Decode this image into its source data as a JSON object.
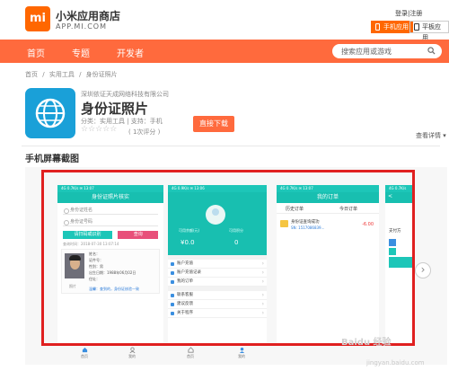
{
  "header": {
    "brand": "小米应用商店",
    "url": "APP.MI.COM",
    "login": "登录",
    "sep": "|",
    "register": "注册",
    "phone_tab": "手机应用",
    "pad_tab": "平板应用"
  },
  "nav": {
    "items": [
      "首页",
      "专题",
      "开发者"
    ],
    "search_placeholder": "搜索应用或游戏"
  },
  "breadcrumb": [
    "首页",
    "/",
    "实用工具",
    "/",
    "身份证照片"
  ],
  "app": {
    "developer": "深圳依证天成网络科技有限公司",
    "title": "身份证照片",
    "meta": "分类：实用工具 | 支持：手机",
    "stars": "☆☆☆☆☆",
    "rating_count": "( 1次评分 )",
    "download": "直接下载",
    "detail_link": "查看详情 ▾"
  },
  "section_title": "手机屏幕截图",
  "shot1": {
    "status": "4G  0.7K/s  ✉     13:07",
    "title": "身份证照片核实",
    "field_name": "身份证姓名",
    "field_id": "身份证号码",
    "btn_submit": "请扫码或识别",
    "btn_query": "查询",
    "time": "查询时间：2018-07-30 13:07:14",
    "line_name": "姓名：",
    "line_id": "证件号：",
    "line_sex": "性别：男",
    "line_birth": "出生日期：1988年06月02日",
    "line_addr": "住址：",
    "caption": "照片",
    "note": "温馨：查到的，身份证核验一致"
  },
  "shot2": {
    "status": "4G  0.9K/s  ✉     13:06",
    "label_balance": "可用余额(元)",
    "label_points": "可用积分",
    "balance": "¥0.0",
    "points": "0",
    "rows1": [
      "账户充值",
      "账户充值记录",
      "我的订单"
    ],
    "rows2": [
      "联系客服",
      "建议反馈",
      "关于程序"
    ]
  },
  "shot3": {
    "status": "4G  0.7K/s  ✉     13:07",
    "title": "我的订单",
    "tab_history": "历史订单",
    "tab_today": "今日订单",
    "item_name": "身份证查询成功",
    "item_sn": "SN: 1517086839...",
    "item_amount": "-6.00"
  },
  "shot4": {
    "status": "4G  0.7K/s",
    "back": "<",
    "pay_text": "支付方"
  },
  "bottom_nav": [
    "首页",
    "我的",
    "首页",
    "我的"
  ],
  "watermark": "Baidu 经验",
  "watermark_url": "jingyan.baidu.com",
  "colors": {
    "accent": "#ff6a3d",
    "brand": "#ff6700",
    "teal": "#1dc6b8",
    "highlight": "#e02020",
    "icon_blue": "#1aa0d8"
  }
}
